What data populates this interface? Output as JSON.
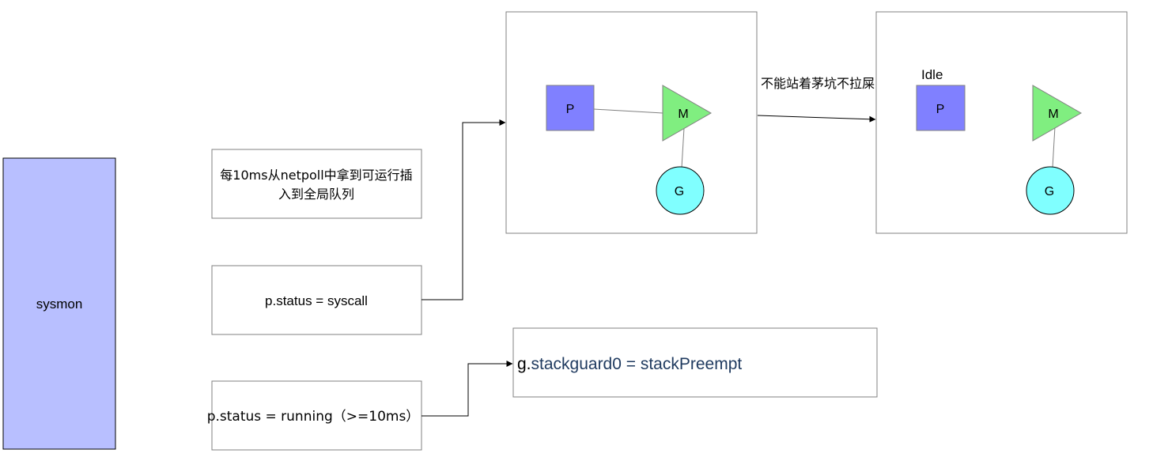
{
  "sysmon": {
    "label": "sysmon",
    "fill": "#b8bfff"
  },
  "conditions": {
    "netpoll_line1": "每10ms从netpoll中拿到可运行插",
    "netpoll_line2": "入到全局队列",
    "syscall": "p.status = syscall",
    "running": "p.status = running（>=10ms）"
  },
  "preempt": {
    "text_prefix": "g.",
    "text_rest": "stackguard0 = stackPreempt",
    "rest_color": "#1f3a5f"
  },
  "handoff": {
    "label": "不能站着茅坑不拉屎"
  },
  "before": {
    "p_label": "P",
    "m_label": "M",
    "g_label": "G"
  },
  "after": {
    "status_label": "Idle",
    "p_label": "P",
    "m_label": "M",
    "g_label": "G"
  },
  "colors": {
    "p_fill": "#8080ff",
    "m_fill": "#80ee80",
    "g_fill": "#80ffff",
    "border": "#808080"
  }
}
